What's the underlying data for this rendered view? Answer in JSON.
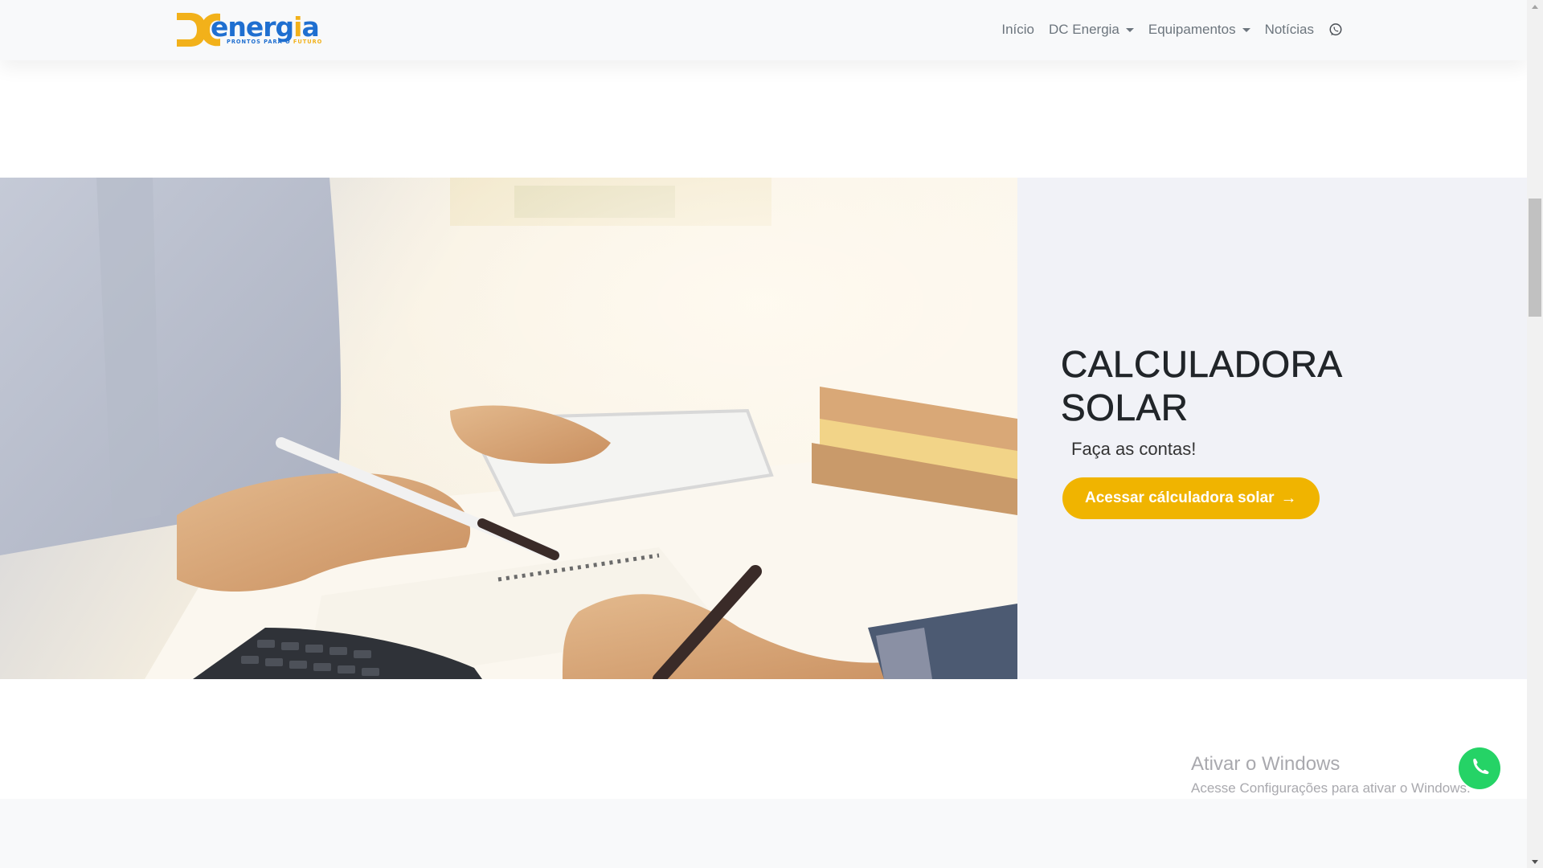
{
  "navbar": {
    "logo": {
      "word_main": "energ",
      "word_accent": "i",
      "word_end": "a",
      "tagline_main": "PRONTOS PARA O ",
      "tagline_accent": "FUTURO"
    },
    "links": [
      {
        "label": "Início",
        "dropdown": false
      },
      {
        "label": "DC Energia",
        "dropdown": true
      },
      {
        "label": "Equipamentos",
        "dropdown": true
      },
      {
        "label": "Notícias",
        "dropdown": false
      }
    ],
    "whatsapp_icon": "whatsapp-icon"
  },
  "hero": {
    "title": "CALCULADORA SOLAR",
    "subtitle": "Faça as contas!",
    "button_label": "Acessar cálculadora solar",
    "button_icon": "arrow-right-icon"
  },
  "watermark": {
    "title": "Ativar o Windows",
    "subtitle": "Acesse Configurações para ativar o Windows."
  },
  "colors": {
    "brand_blue": "#1f6fd0",
    "brand_yellow": "#f0b400",
    "whatsapp_green": "#25d366",
    "hero_bg": "#f1f2f7"
  }
}
